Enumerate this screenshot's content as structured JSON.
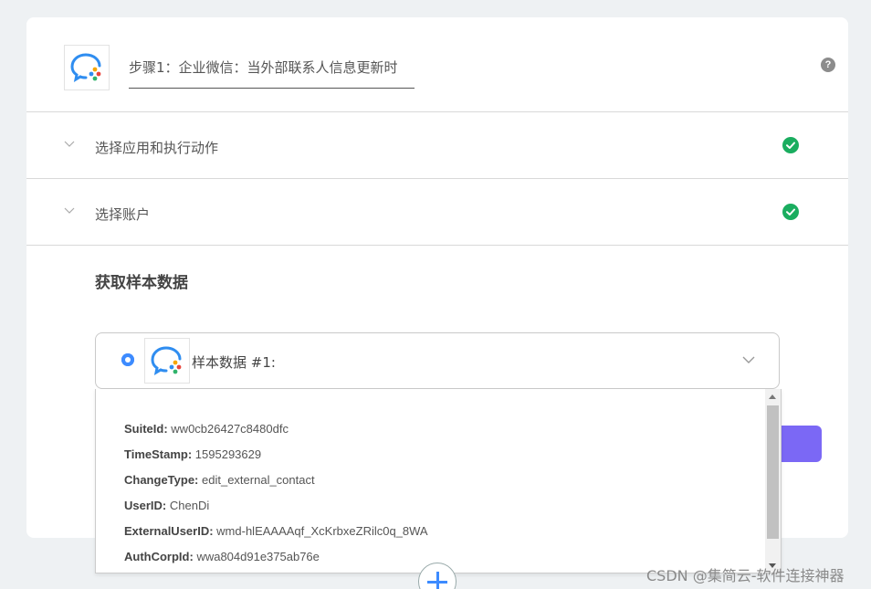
{
  "step": {
    "title": "步骤1：企业微信：当外部联系人信息更新时",
    "help_icon": "?"
  },
  "sections": [
    {
      "label": "选择应用和执行动作",
      "status": "completed"
    },
    {
      "label": "选择账户",
      "status": "completed"
    }
  ],
  "sample": {
    "title": "获取样本数据",
    "select_label": "样本数据 #1:",
    "fields": [
      {
        "key": "SuiteId:",
        "value": "ww0cb26427c8480dfc"
      },
      {
        "key": "TimeStamp:",
        "value": "1595293629"
      },
      {
        "key": "ChangeType:",
        "value": "edit_external_contact"
      },
      {
        "key": "UserID:",
        "value": "ChenDi"
      },
      {
        "key": "ExternalUserID:",
        "value": "wmd-hlEAAAAqf_XcKrbxeZRilc0q_8WA"
      },
      {
        "key": "AuthCorpId:",
        "value": "wwa804d91e375ab76e"
      }
    ]
  },
  "watermark": "CSDN @集简云-软件连接神器",
  "colors": {
    "accent_blue": "#3d8bff",
    "success_green": "#1aad5f",
    "button_purple": "#7b68f5"
  },
  "icons": {
    "app_logo": "wecom-logo-icon",
    "check": "check-circle-icon",
    "chevron": "chevron-down-icon",
    "add": "plus-circle-icon"
  }
}
